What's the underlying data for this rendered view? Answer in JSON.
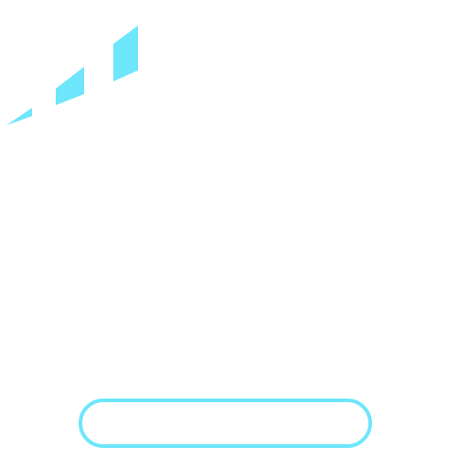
{
  "theme": {
    "accent_color": "#6ee6fb",
    "background_color": "#ffffff"
  },
  "signal_icon": {
    "icon": "signal-strength-icon"
  },
  "action_button": {
    "label": ""
  }
}
